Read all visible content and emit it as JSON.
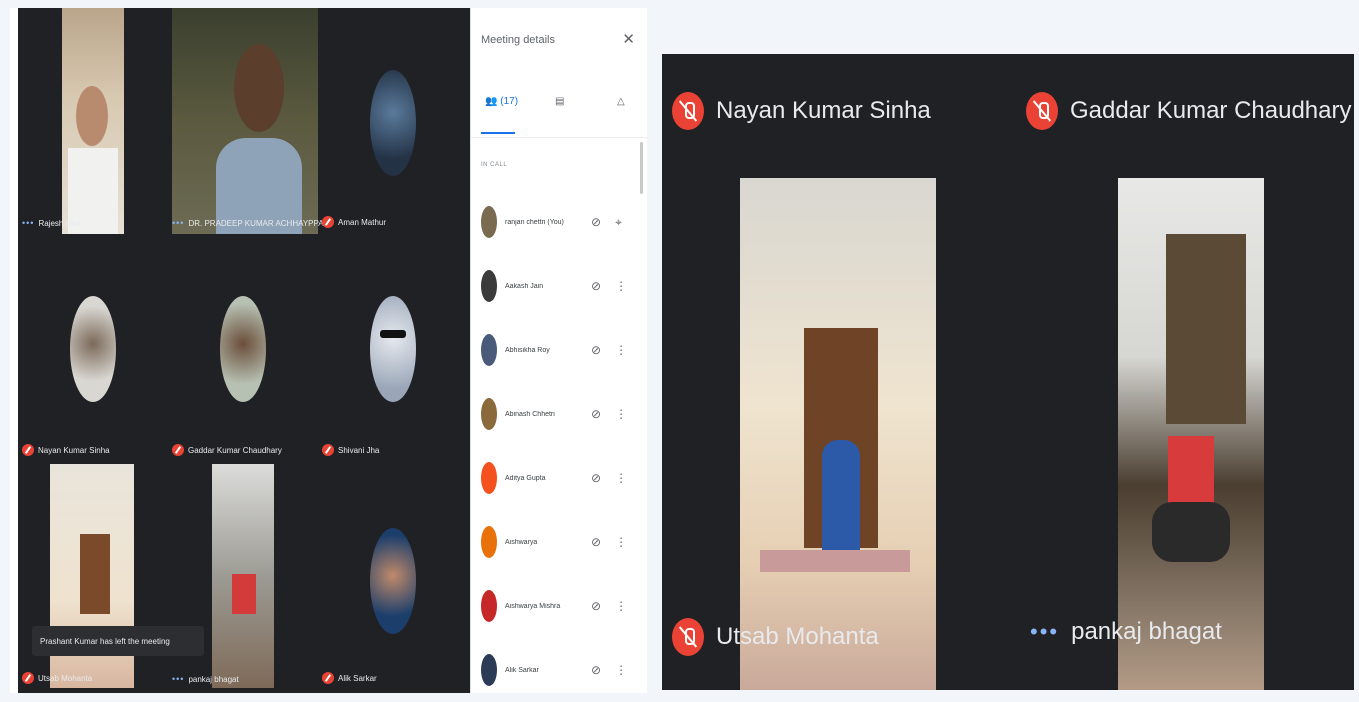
{
  "left_grid": {
    "tiles": [
      {
        "name": "Rajesh Dixit",
        "mic": "speaking"
      },
      {
        "name": "DR. PRADEEP KUMAR ACHHAYPPA",
        "mic": "speaking"
      },
      {
        "name": "Aman Mathur",
        "mic": "muted"
      },
      {
        "name": "Nayan Kumar Sinha",
        "mic": "muted"
      },
      {
        "name": "Gaddar Kumar Chaudhary",
        "mic": "muted"
      },
      {
        "name": "Shivani Jha",
        "mic": "muted"
      },
      {
        "name": "Utsab Mohanta",
        "mic": "muted"
      },
      {
        "name": "pankaj bhagat",
        "mic": "speaking"
      },
      {
        "name": "Alik Sarkar",
        "mic": "muted"
      }
    ],
    "toast": "Prashant Kumar has left the meeting"
  },
  "meeting_panel": {
    "title": "Meeting details",
    "close_icon": "close-icon",
    "tabs": [
      {
        "label": "(17)",
        "icon": "people-icon"
      },
      {
        "label": "",
        "icon": "chat-icon"
      },
      {
        "label": "",
        "icon": "activities-icon"
      }
    ],
    "section_label": "IN CALL",
    "participants": [
      {
        "name": "ranjan chettri (You)",
        "color": "#7a6a50"
      },
      {
        "name": "Aakash Jain",
        "color": "#3b3b3b"
      },
      {
        "name": "Abhisikha Roy",
        "color": "#4a5a7a"
      },
      {
        "name": "Abinash Chhetri",
        "color": "#8a6a3a"
      },
      {
        "name": "Aditya Gupta",
        "color": "#f4511e"
      },
      {
        "name": "Aishwarya",
        "color": "#e8710a"
      },
      {
        "name": "Aishwarya Mishra",
        "color": "#c62828"
      },
      {
        "name": "Alik Sarkar",
        "color": "#2b3a55"
      }
    ]
  },
  "right_grid": {
    "tiles": [
      {
        "name": "Nayan Kumar Sinha",
        "mic": "muted"
      },
      {
        "name": "Gaddar Kumar Chaudhary",
        "mic": "muted"
      },
      {
        "name": "Utsab Mohanta",
        "mic": "muted"
      },
      {
        "name": "pankaj bhagat",
        "mic": "speaking"
      }
    ]
  },
  "colors": {
    "tile_bg": "#202124",
    "mic_off": "#ea4335",
    "accent": "#1a73e8",
    "speaking": "#8ab4f8"
  }
}
